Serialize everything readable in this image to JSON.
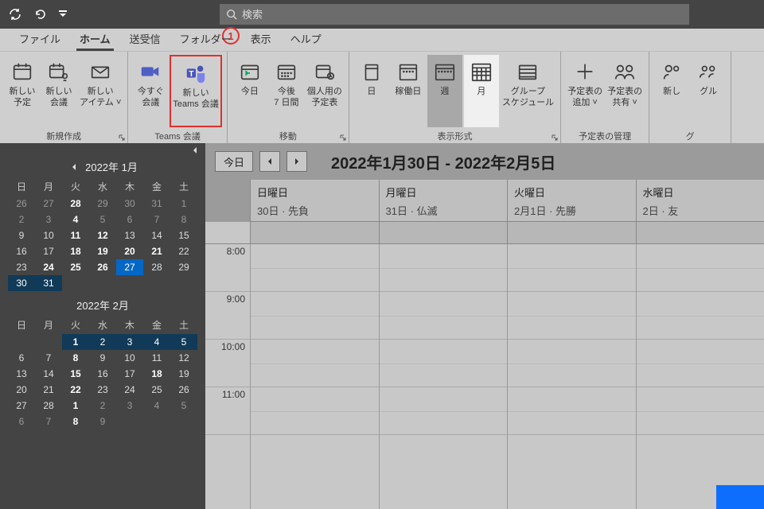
{
  "titlebar": {
    "search_placeholder": "検索"
  },
  "menu": {
    "tabs": [
      "ファイル",
      "ホーム",
      "送受信",
      "フォルダー",
      "表示",
      "ヘルプ"
    ],
    "active_index": 1,
    "annotation_number": "1"
  },
  "ribbon": {
    "groups": [
      {
        "label": "新規作成",
        "buttons": [
          {
            "name": "new-appointment",
            "line1": "新しい",
            "line2": "予定"
          },
          {
            "name": "new-meeting",
            "line1": "新しい",
            "line2": "会議"
          },
          {
            "name": "new-items",
            "line1": "新しい",
            "line2": "アイテム ˅"
          }
        ],
        "launcher": true
      },
      {
        "label": "Teams 会議",
        "buttons": [
          {
            "name": "meet-now",
            "line1": "今すぐ",
            "line2": "会議"
          },
          {
            "name": "new-teams-meeting",
            "line1": "新しい",
            "line2": "Teams 会議",
            "highlighted": true
          }
        ]
      },
      {
        "label": "移動",
        "buttons": [
          {
            "name": "goto-today",
            "line1": "今日",
            "line2": ""
          },
          {
            "name": "next-7-days",
            "line1": "今後",
            "line2": "7 日間"
          },
          {
            "name": "personal-calendar",
            "line1": "個人用の",
            "line2": "予定表"
          }
        ],
        "launcher": true
      },
      {
        "label": "表示形式",
        "buttons": [
          {
            "name": "view-day",
            "line1": "日",
            "line2": ""
          },
          {
            "name": "view-workweek",
            "line1": "稼働日",
            "line2": ""
          },
          {
            "name": "view-week",
            "line1": "週",
            "line2": "",
            "selected": true
          },
          {
            "name": "view-month",
            "line1": "月",
            "line2": "",
            "lightsel": true
          },
          {
            "name": "group-schedule",
            "line1": "グループ",
            "line2": "スケジュール"
          }
        ],
        "launcher": true
      },
      {
        "label": "予定表の管理",
        "buttons": [
          {
            "name": "add-calendar",
            "line1": "予定表の",
            "line2": "追加 ˅"
          },
          {
            "name": "share-calendar",
            "line1": "予定表の",
            "line2": "共有 ˅"
          }
        ]
      },
      {
        "label": "グ",
        "buttons": [
          {
            "name": "new-group",
            "line1": "新し",
            "line2": ""
          },
          {
            "name": "browse-groups",
            "line1": "グル",
            "line2": ""
          }
        ]
      }
    ]
  },
  "sidebar": {
    "months": [
      {
        "title": "2022年 1月",
        "show_prev_arrow": true,
        "dow": [
          "日",
          "月",
          "火",
          "水",
          "木",
          "金",
          "土"
        ],
        "rows": [
          [
            {
              "t": "26",
              "c": "dim"
            },
            {
              "t": "27",
              "c": "dim"
            },
            {
              "t": "28",
              "c": "bold"
            },
            {
              "t": "29",
              "c": "dim"
            },
            {
              "t": "30",
              "c": "dim"
            },
            {
              "t": "31",
              "c": "dim"
            },
            {
              "t": "1",
              "c": "dim"
            }
          ],
          [
            {
              "t": "2",
              "c": "dim"
            },
            {
              "t": "3",
              "c": "dim"
            },
            {
              "t": "4",
              "c": "bold"
            },
            {
              "t": "5",
              "c": "dim"
            },
            {
              "t": "6",
              "c": "dim"
            },
            {
              "t": "7",
              "c": "dim"
            },
            {
              "t": "8",
              "c": "dim"
            }
          ],
          [
            {
              "t": "9",
              "c": ""
            },
            {
              "t": "10",
              "c": ""
            },
            {
              "t": "11",
              "c": "bold"
            },
            {
              "t": "12",
              "c": "bold"
            },
            {
              "t": "13",
              "c": ""
            },
            {
              "t": "14",
              "c": ""
            },
            {
              "t": "15",
              "c": ""
            }
          ],
          [
            {
              "t": "16",
              "c": ""
            },
            {
              "t": "17",
              "c": ""
            },
            {
              "t": "18",
              "c": "bold"
            },
            {
              "t": "19",
              "c": "bold"
            },
            {
              "t": "20",
              "c": "bold"
            },
            {
              "t": "21",
              "c": "bold"
            },
            {
              "t": "22",
              "c": ""
            }
          ],
          [
            {
              "t": "23",
              "c": ""
            },
            {
              "t": "24",
              "c": "bold"
            },
            {
              "t": "25",
              "c": "bold"
            },
            {
              "t": "26",
              "c": "bold"
            },
            {
              "t": "27",
              "c": "today"
            },
            {
              "t": "28",
              "c": ""
            },
            {
              "t": "29",
              "c": ""
            }
          ],
          [
            {
              "t": "30",
              "c": "sel"
            },
            {
              "t": "31",
              "c": "sel"
            },
            {
              "t": "",
              "c": ""
            },
            {
              "t": "",
              "c": ""
            },
            {
              "t": "",
              "c": ""
            },
            {
              "t": "",
              "c": ""
            },
            {
              "t": "",
              "c": ""
            }
          ]
        ]
      },
      {
        "title": "2022年 2月",
        "show_prev_arrow": false,
        "dow": [
          "日",
          "月",
          "火",
          "水",
          "木",
          "金",
          "土"
        ],
        "rows": [
          [
            {
              "t": "",
              "c": ""
            },
            {
              "t": "",
              "c": ""
            },
            {
              "t": "1",
              "c": "sel bold"
            },
            {
              "t": "2",
              "c": "sel"
            },
            {
              "t": "3",
              "c": "sel"
            },
            {
              "t": "4",
              "c": "sel"
            },
            {
              "t": "5",
              "c": "sel"
            }
          ],
          [
            {
              "t": "6",
              "c": ""
            },
            {
              "t": "7",
              "c": ""
            },
            {
              "t": "8",
              "c": "bold"
            },
            {
              "t": "9",
              "c": ""
            },
            {
              "t": "10",
              "c": ""
            },
            {
              "t": "11",
              "c": ""
            },
            {
              "t": "12",
              "c": ""
            }
          ],
          [
            {
              "t": "13",
              "c": ""
            },
            {
              "t": "14",
              "c": ""
            },
            {
              "t": "15",
              "c": "bold"
            },
            {
              "t": "16",
              "c": ""
            },
            {
              "t": "17",
              "c": ""
            },
            {
              "t": "18",
              "c": "bold"
            },
            {
              "t": "19",
              "c": ""
            }
          ],
          [
            {
              "t": "20",
              "c": ""
            },
            {
              "t": "21",
              "c": ""
            },
            {
              "t": "22",
              "c": "bold"
            },
            {
              "t": "23",
              "c": ""
            },
            {
              "t": "24",
              "c": ""
            },
            {
              "t": "25",
              "c": ""
            },
            {
              "t": "26",
              "c": ""
            }
          ],
          [
            {
              "t": "27",
              "c": ""
            },
            {
              "t": "28",
              "c": ""
            },
            {
              "t": "1",
              "c": "bold"
            },
            {
              "t": "2",
              "c": "dim"
            },
            {
              "t": "3",
              "c": "dim"
            },
            {
              "t": "4",
              "c": "dim"
            },
            {
              "t": "5",
              "c": "dim"
            }
          ],
          [
            {
              "t": "6",
              "c": "dim"
            },
            {
              "t": "7",
              "c": "dim"
            },
            {
              "t": "8",
              "c": "bold"
            },
            {
              "t": "9",
              "c": "dim"
            },
            {
              "t": "",
              "c": ""
            },
            {
              "t": "",
              "c": ""
            },
            {
              "t": "",
              "c": ""
            }
          ]
        ]
      }
    ]
  },
  "calendar": {
    "today_label": "今日",
    "range_title": "2022年1月30日 - 2022年2月5日",
    "days": [
      {
        "name": "日曜日",
        "date": "30日 · 先負"
      },
      {
        "name": "月曜日",
        "date": "31日 · 仏滅"
      },
      {
        "name": "火曜日",
        "date": "2月1日 · 先勝"
      },
      {
        "name": "水曜日",
        "date": "2日 · 友"
      }
    ],
    "times": [
      "8:00",
      "9:00",
      "10:00",
      "11:00"
    ]
  }
}
